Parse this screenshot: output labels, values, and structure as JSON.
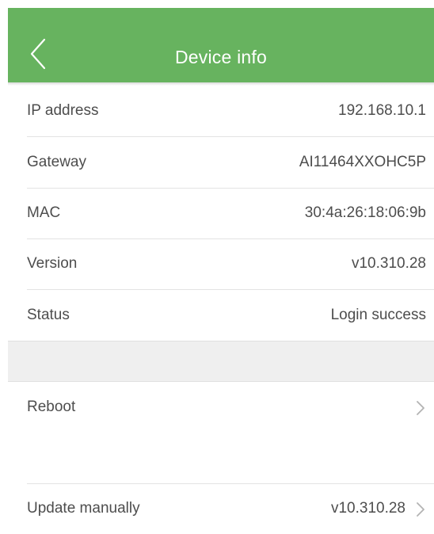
{
  "header": {
    "title": "Device info",
    "back_icon": "chevron-left-icon",
    "color": "#67b35f"
  },
  "info": {
    "ip": {
      "label": "IP address",
      "value": "192.168.10.1"
    },
    "gateway": {
      "label": "Gateway",
      "value": "AI11464XXOHC5P"
    },
    "mac": {
      "label": "MAC",
      "value": "30:4a:26:18:06:9b"
    },
    "version": {
      "label": "Version",
      "value": "v10.310.28"
    },
    "status": {
      "label": "Status",
      "value": "Login success"
    }
  },
  "actions": {
    "reboot": {
      "label": "Reboot",
      "icon": "chevron-right-icon"
    },
    "update": {
      "label": "Update manually",
      "value": "v10.310.28",
      "icon": "chevron-right-icon"
    }
  }
}
